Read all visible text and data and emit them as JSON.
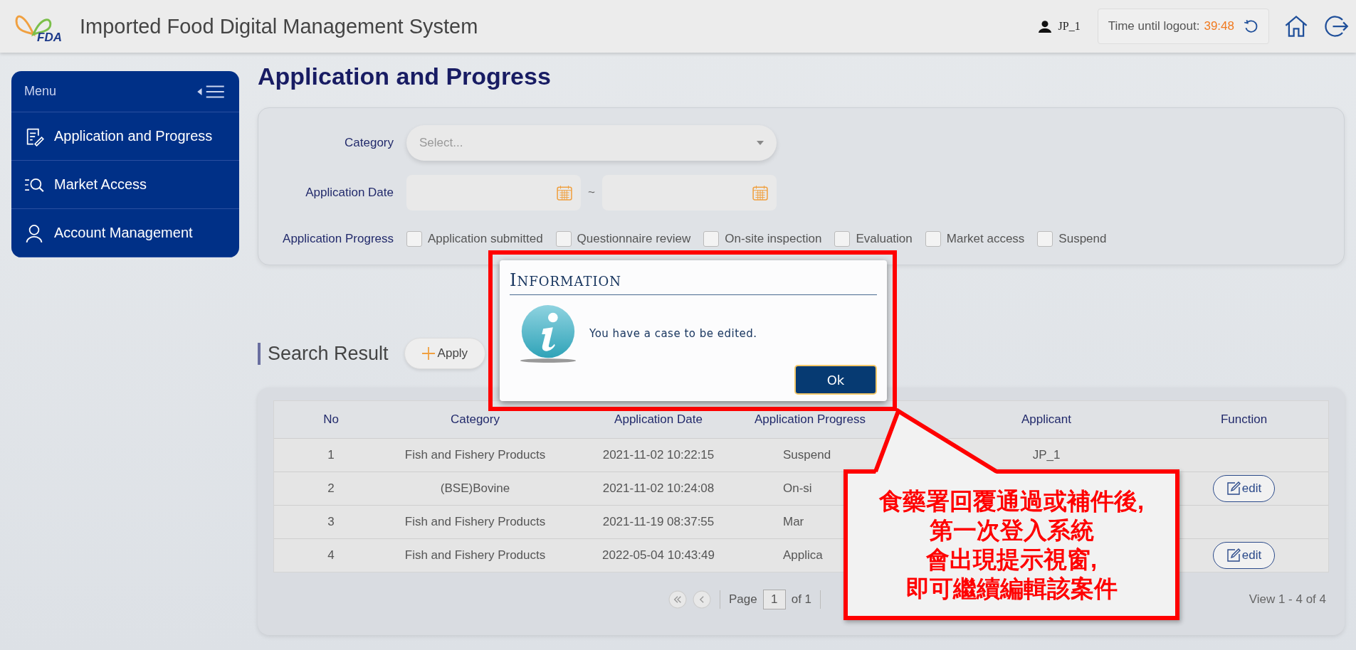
{
  "header": {
    "logo_text": "FDA",
    "title": "Imported Food Digital Management System",
    "user": "JP_1",
    "logout_label": "Time until logout:",
    "logout_time": "39:48"
  },
  "sidebar": {
    "title": "Menu",
    "items": [
      {
        "label": "Application and Progress",
        "kind": "form",
        "selected": false
      },
      {
        "label": "Market Access",
        "kind": "search",
        "selected": false
      },
      {
        "label": "Account Management",
        "kind": "person",
        "selected": false
      }
    ]
  },
  "page_title": "Application and Progress",
  "filters": {
    "category_label": "Category",
    "category_placeholder": "Select...",
    "date_label": "Application Date",
    "date_separator": "~",
    "progress_label": "Application Progress",
    "progress_options": [
      {
        "label": "Application submitted",
        "checked": false
      },
      {
        "label": "Questionnaire review",
        "checked": false
      },
      {
        "label": "On-site inspection",
        "checked": false
      },
      {
        "label": "Evaluation",
        "checked": false
      },
      {
        "label": "Market access",
        "checked": false
      },
      {
        "label": "Suspend",
        "checked": false
      }
    ]
  },
  "results": {
    "title": "Search Result",
    "apply_button": "Apply"
  },
  "table": {
    "columns": [
      "No",
      "Category",
      "Application Date",
      "Application Progress",
      "Applicant",
      "Function"
    ],
    "rows": [
      {
        "no": "1",
        "category": "Fish and Fishery Products",
        "date": "2021-11-02 10:22:15",
        "progress": "Suspend",
        "applicant": "JP_1"
      },
      {
        "no": "2",
        "category": "(BSE)Bovine",
        "date": "2021-11-02 10:24:08",
        "progress": "On-si",
        "action": "edit"
      },
      {
        "no": "3",
        "category": "Fish and Fishery Products",
        "date": "2021-11-19 08:37:55",
        "progress": "Mar"
      },
      {
        "no": "4",
        "category": "Fish and Fishery Products",
        "date": "2022-05-04 10:43:49",
        "progress": "Applica",
        "action": "edit"
      }
    ]
  },
  "pagination": {
    "page_label": "Page",
    "page": "1",
    "of": "of 1",
    "view": "View 1 - 4 of 4"
  },
  "dialog": {
    "title": "INFORMATION",
    "message": "You have a case to be edited.",
    "button": "Ok"
  },
  "callout": {
    "lines": [
      "食藥署回覆通過或補件後,",
      "第一次登入系統",
      "會出現提示視窗,",
      "即可繼續編輯該案件"
    ]
  }
}
